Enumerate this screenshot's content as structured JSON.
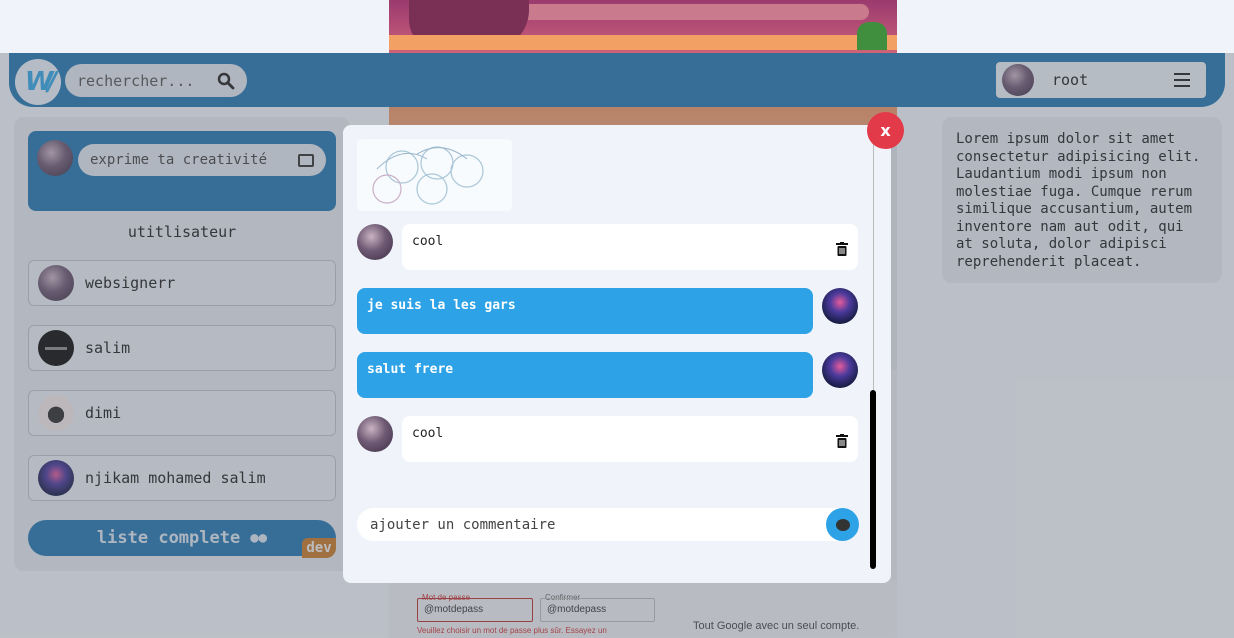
{
  "navbar": {
    "search_placeholder": "rechercher...",
    "username": "root"
  },
  "sidebar": {
    "compose_placeholder": "exprime ta creativité",
    "section_title": "utitlisateur",
    "users": [
      {
        "name": "websignerr"
      },
      {
        "name": "salim"
      },
      {
        "name": "dimi"
      },
      {
        "name": "njikam mohamed salim"
      }
    ],
    "list_button": "liste complete",
    "badge": "dev"
  },
  "right_panel": {
    "text": "Lorem ipsum dolor sit amet consectetur adipisicing elit. Laudantium modi ipsum non molestiae fuga. Cumque rerum similique accusantium, autem inventore nam aut odit, qui at soluta, dolor adipisci reprehenderit placeat."
  },
  "background_form": {
    "password_label": "Mot de passe",
    "password_value": "@motdepass",
    "confirm_label": "Confirmer",
    "confirm_value": "@motdepass",
    "error": "Veuillez choisir un mot de passe plus sûr. Essayez un",
    "tagline": "Tout Google avec un seul compte."
  },
  "modal": {
    "close_label": "x",
    "comments": [
      {
        "text": "cool",
        "mine": false,
        "deletable": true
      },
      {
        "text": "je suis la les gars",
        "mine": true,
        "deletable": false
      },
      {
        "text": "salut frere",
        "mine": true,
        "deletable": false
      },
      {
        "text": "cool",
        "mine": false,
        "deletable": true
      }
    ],
    "comment_placeholder": "ajouter un commentaire"
  },
  "colors": {
    "navbar": "#2577b0",
    "bubble_blue": "#2ea2e6",
    "close_red": "#e33a4a",
    "badge_orange": "#c67a2c"
  }
}
